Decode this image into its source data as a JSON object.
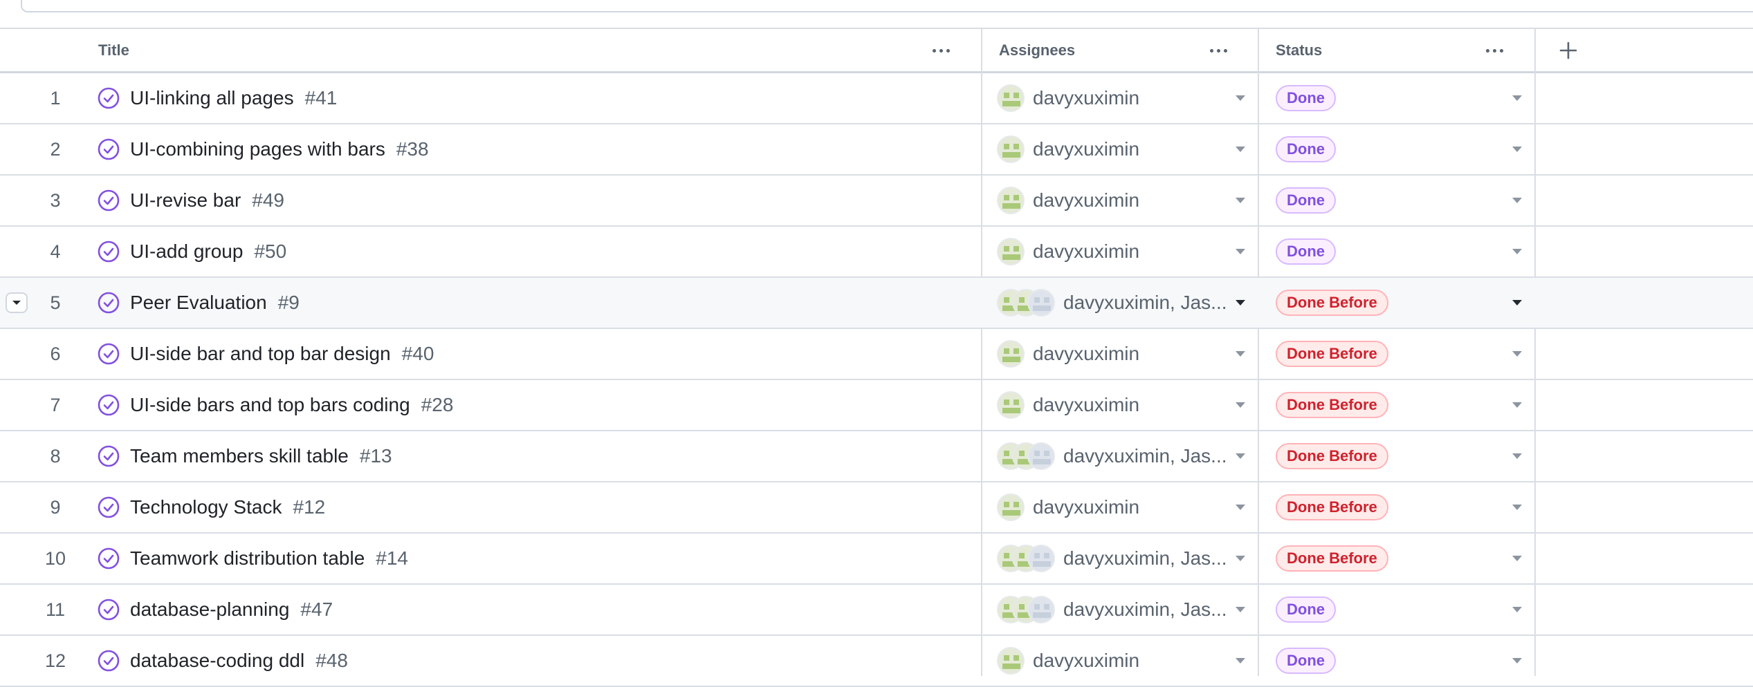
{
  "header": {
    "columns": [
      {
        "key": "title",
        "label": "Title"
      },
      {
        "key": "assignees",
        "label": "Assignees"
      },
      {
        "key": "status",
        "label": "Status"
      }
    ],
    "add_column_icon": "plus-icon",
    "column_menu_icon": "kebab-horizontal-icon"
  },
  "colors": {
    "done_text": "#8250df",
    "done_bg": "#fbefff",
    "done_before_text": "#cf222e",
    "done_before_bg": "#ffebe9",
    "closed_issue_icon": "#8250df"
  },
  "rows": [
    {
      "num": "1",
      "title": "UI-linking all pages",
      "issue": "#41",
      "assignees": "davyxuximin",
      "avatars": 1,
      "status": "Done",
      "status_kind": "done"
    },
    {
      "num": "2",
      "title": "UI-combining pages with bars",
      "issue": "#38",
      "assignees": "davyxuximin",
      "avatars": 1,
      "status": "Done",
      "status_kind": "done"
    },
    {
      "num": "3",
      "title": "UI-revise bar",
      "issue": "#49",
      "assignees": "davyxuximin",
      "avatars": 1,
      "status": "Done",
      "status_kind": "done"
    },
    {
      "num": "4",
      "title": "UI-add group",
      "issue": "#50",
      "assignees": "davyxuximin",
      "avatars": 1,
      "status": "Done",
      "status_kind": "done"
    },
    {
      "num": "5",
      "title": "Peer Evaluation",
      "issue": "#9",
      "assignees": "davyxuximin, Jas...",
      "avatars": 3,
      "status": "Done Before",
      "status_kind": "done-before",
      "hovered": true
    },
    {
      "num": "6",
      "title": "UI-side bar and top bar design",
      "issue": "#40",
      "assignees": "davyxuximin",
      "avatars": 1,
      "status": "Done Before",
      "status_kind": "done-before"
    },
    {
      "num": "7",
      "title": "UI-side bars and top bars coding",
      "issue": "#28",
      "assignees": "davyxuximin",
      "avatars": 1,
      "status": "Done Before",
      "status_kind": "done-before"
    },
    {
      "num": "8",
      "title": "Team members skill table",
      "issue": "#13",
      "assignees": "davyxuximin, Jas...",
      "avatars": 3,
      "status": "Done Before",
      "status_kind": "done-before"
    },
    {
      "num": "9",
      "title": "Technology Stack",
      "issue": "#12",
      "assignees": "davyxuximin",
      "avatars": 1,
      "status": "Done Before",
      "status_kind": "done-before"
    },
    {
      "num": "10",
      "title": "Teamwork distribution table",
      "issue": "#14",
      "assignees": "davyxuximin, Jas...",
      "avatars": 3,
      "status": "Done Before",
      "status_kind": "done-before"
    },
    {
      "num": "11",
      "title": "database-planning",
      "issue": "#47",
      "assignees": "davyxuximin, Jas...",
      "avatars": 3,
      "status": "Done",
      "status_kind": "done"
    },
    {
      "num": "12",
      "title": "database-coding ddl",
      "issue": "#48",
      "assignees": "davyxuximin",
      "avatars": 1,
      "status": "Done",
      "status_kind": "done"
    }
  ]
}
